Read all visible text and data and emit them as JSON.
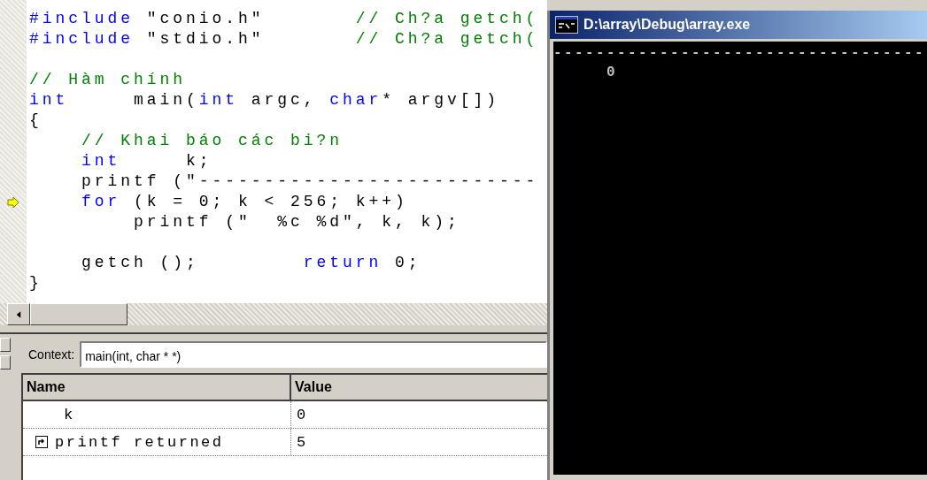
{
  "editor": {
    "lines": [
      {
        "current": false,
        "tokens": [
          {
            "kind": "keyword",
            "text": "#include"
          },
          {
            "kind": "plain",
            "text": " \"conio.h\"       "
          },
          {
            "kind": "comment",
            "text": "// Ch?a getch("
          }
        ]
      },
      {
        "current": false,
        "tokens": [
          {
            "kind": "keyword",
            "text": "#include"
          },
          {
            "kind": "plain",
            "text": " \"stdio.h\"       "
          },
          {
            "kind": "comment",
            "text": "// Ch?a getch("
          }
        ]
      },
      {
        "current": false
      },
      {
        "current": false,
        "tokens": [
          {
            "kind": "comment",
            "text": "// Hàm chính"
          }
        ]
      },
      {
        "current": false,
        "tokens": [
          {
            "kind": "keyword",
            "text": "int"
          },
          {
            "kind": "plain",
            "text": "     main("
          },
          {
            "kind": "keyword",
            "text": "int"
          },
          {
            "kind": "plain",
            "text": " argc, "
          },
          {
            "kind": "keyword",
            "text": "char"
          },
          {
            "kind": "plain",
            "text": "* argv[])"
          }
        ]
      },
      {
        "current": false,
        "tokens": [
          {
            "kind": "plain",
            "text": "{"
          }
        ]
      },
      {
        "current": false,
        "tokens": [
          {
            "kind": "comment",
            "text": "    // Khai báo các bi?n"
          }
        ]
      },
      {
        "current": false,
        "tokens": [
          {
            "kind": "keyword",
            "text": "    int"
          },
          {
            "kind": "plain",
            "text": "     k;"
          }
        ]
      },
      {
        "current": false,
        "tokens": [
          {
            "kind": "plain",
            "text": "    printf (\"--------------------------"
          }
        ]
      },
      {
        "current": true,
        "tokens": [
          {
            "kind": "keyword",
            "text": "    for"
          },
          {
            "kind": "plain",
            "text": " (k = 0; k < 256; k++)"
          }
        ]
      },
      {
        "current": false,
        "tokens": [
          {
            "kind": "plain",
            "text": "        printf (\"  %c %d\", k, k);"
          }
        ]
      },
      {
        "current": false
      },
      {
        "current": false,
        "tokens": [
          {
            "kind": "plain",
            "text": "    getch ();        "
          },
          {
            "kind": "keyword",
            "text": "return"
          },
          {
            "kind": "plain",
            "text": " 0;"
          }
        ]
      },
      {
        "current": false,
        "tokens": [
          {
            "kind": "plain",
            "text": "}"
          }
        ]
      }
    ]
  },
  "locals": {
    "context_label": "Context:",
    "context_value": "main(int, char * *)",
    "columns": [
      "Name",
      "Value"
    ],
    "rows": [
      {
        "kind": "variable",
        "name": "k",
        "value": "0"
      },
      {
        "kind": "return",
        "name": "printf returned",
        "value": "5"
      }
    ]
  },
  "console": {
    "title": "D:\\array\\Debug\\array.exe",
    "lines": [
      "-----------------------------------",
      "     0"
    ]
  }
}
